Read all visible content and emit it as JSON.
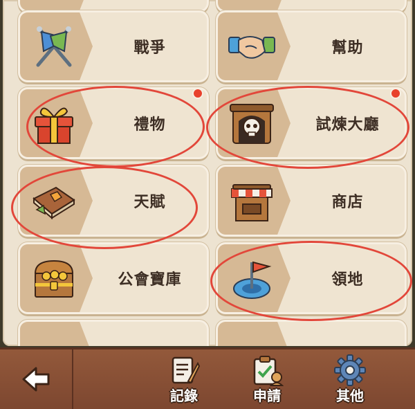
{
  "menu": {
    "war": "戰爭",
    "help": "幫助",
    "gift": "禮物",
    "trial_hall": "試煉大廳",
    "talent": "天賦",
    "shop": "商店",
    "guild_vault": "公會寶庫",
    "territory": "領地"
  },
  "bottom": {
    "records": "記錄",
    "apply": "申請",
    "others": "其他"
  },
  "colors": {
    "highlight": "#e2473a",
    "notification": "#e8412c"
  }
}
